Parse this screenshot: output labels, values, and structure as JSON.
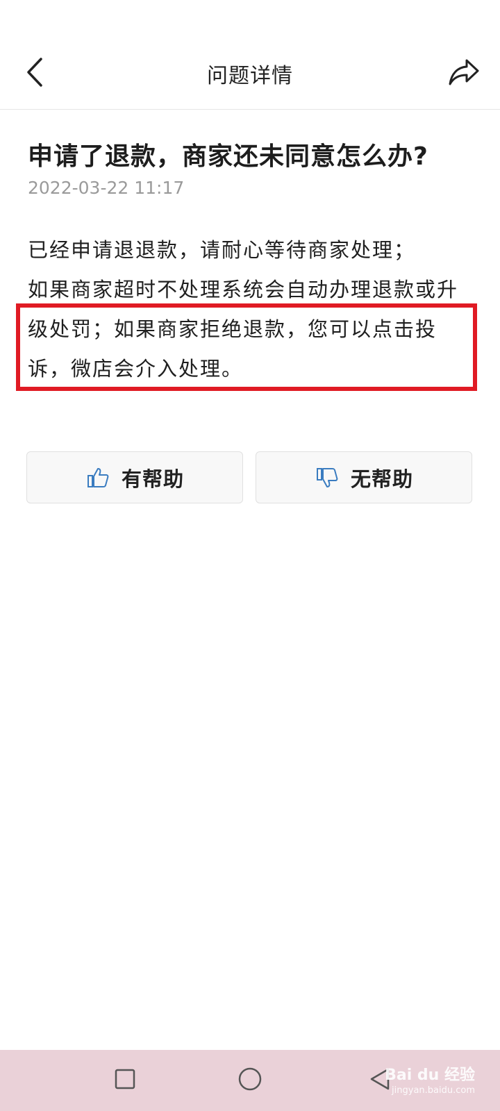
{
  "header": {
    "title": "问题详情",
    "back_icon": "chevron-left-icon",
    "share_icon": "share-arrow-icon"
  },
  "question": {
    "title": "申请了退款，商家还未同意怎么办?",
    "time": "2022-03-22 11:17",
    "body_lines": [
      "已经申请退退款，请耐心等待商家处理；",
      "如果商家超时不处理系统会自动办理退款或升",
      "级处罚；如果商家拒绝退款，您可以点击投",
      "诉，微店会介入处理。"
    ]
  },
  "feedback": {
    "helpful_label": "有帮助",
    "unhelpful_label": "无帮助",
    "icon_color": "#3a7cc0"
  },
  "highlight": {
    "color": "#e01b24"
  },
  "navbar": {
    "background": "#ead1d8"
  },
  "watermark": {
    "text": "Bai du 经验",
    "sub": "jingyan.baidu.com"
  }
}
